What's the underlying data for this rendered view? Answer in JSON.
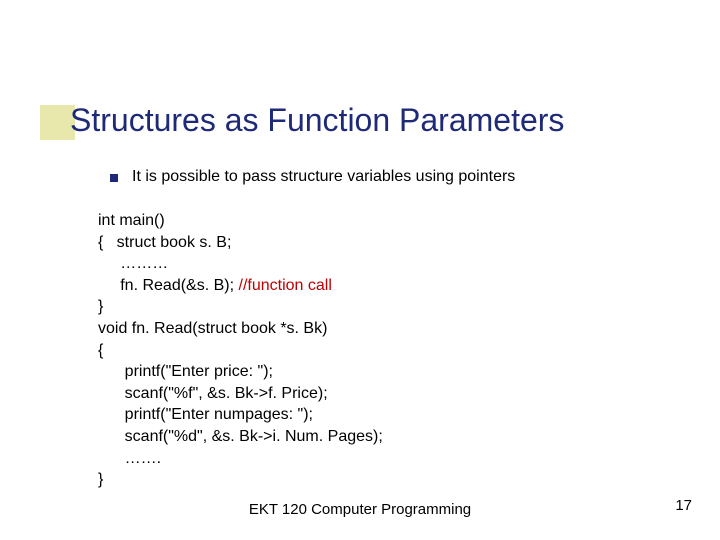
{
  "title": "Structures as Function Parameters",
  "bullet": "It is possible to pass structure variables using pointers",
  "code": {
    "l1": "int main()",
    "l2": "{   struct book s. B;",
    "l3": "     ………",
    "l4a": "     fn. Read(&s. B); ",
    "l4b": "//function call",
    "l5": "}",
    "l6": "void fn. Read(struct book *s. Bk)",
    "l7": "{",
    "l8": "      printf(\"Enter price: \");",
    "l9": "      scanf(\"%f\", &s. Bk->f. Price);",
    "l10": "      printf(\"Enter numpages: \");",
    "l11": "      scanf(\"%d\", &s. Bk->i. Num. Pages);",
    "l12": "      …….",
    "l13": "}"
  },
  "footer": "EKT 120 Computer Programming",
  "page": "17"
}
